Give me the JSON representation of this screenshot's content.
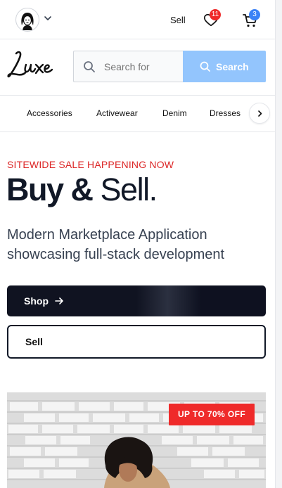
{
  "topbar": {
    "sell_label": "Sell",
    "wishlist_count": "11",
    "cart_count": "3"
  },
  "brand": {
    "logo_text": "Luxe"
  },
  "search": {
    "placeholder": "Search for",
    "button_label": "Search"
  },
  "categories": [
    "Accessories",
    "Activewear",
    "Denim",
    "Dresses"
  ],
  "hero": {
    "eyebrow": "SITEWIDE SALE HAPPENING NOW",
    "headline_bold": "Buy &",
    "headline_light": "Sell.",
    "subtitle": "Modern Marketplace Application showcasing full-stack development",
    "shop_label": "Shop",
    "sell_label": "Sell"
  },
  "promo": {
    "badge": "UP TO 70% OFF"
  },
  "icons": {
    "avatar": "user-avatar-icon",
    "account_menu": "chevron-down-icon",
    "wishlist": "heart-icon",
    "cart": "cart-icon",
    "search": "search-icon",
    "next": "chevron-right-icon",
    "arrow": "arrow-right-icon"
  },
  "colors": {
    "badge_red": "#ef2a2a",
    "badge_blue": "#3b82f6",
    "search_button": "#93c5fd",
    "sale_red": "#dc2626",
    "dark": "#101321"
  }
}
